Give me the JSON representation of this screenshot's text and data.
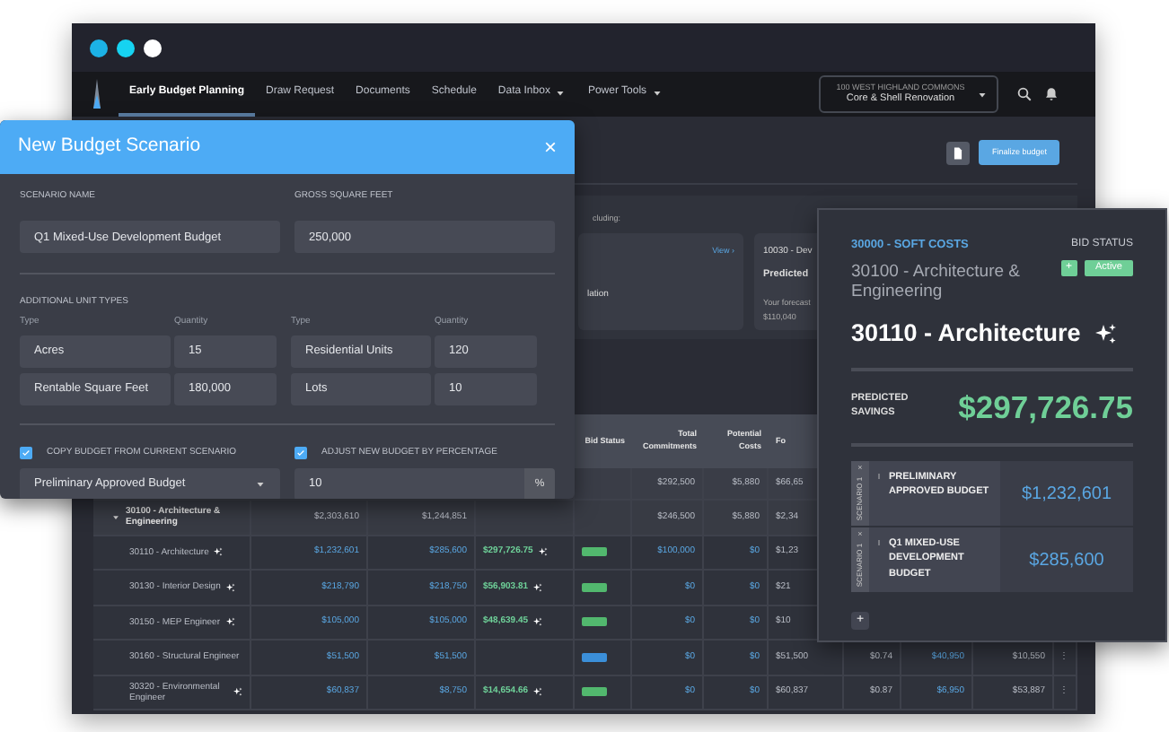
{
  "nav": {
    "tabs": [
      {
        "label": "Early Budget Planning",
        "selected": true,
        "dropdown": false
      },
      {
        "label": "Draw Request",
        "selected": false,
        "dropdown": false
      },
      {
        "label": "Documents",
        "selected": false,
        "dropdown": false
      },
      {
        "label": "Schedule",
        "selected": false,
        "dropdown": false
      },
      {
        "label": "Data Inbox",
        "selected": false,
        "dropdown": true
      },
      {
        "label": "Power Tools",
        "selected": false,
        "dropdown": true
      }
    ],
    "project": {
      "caption": "100 WEST HIGHLAND COMMONS",
      "name": "Core & Shell Renovation"
    }
  },
  "toolbar": {
    "primary_button": "Finalize budget"
  },
  "summary": {
    "intro": "cluding:",
    "cards": [
      {
        "link": "View ›",
        "line": "lation"
      },
      {
        "code": "10030 - Dev",
        "title": "Predicted",
        "note": "Your forecast",
        "amount": "$110,040"
      }
    ]
  },
  "table": {
    "columns": [
      "",
      "",
      "",
      "",
      "Bid Status",
      "Total Commitments",
      "Potential Costs",
      "Fo",
      "",
      "",
      "",
      ""
    ],
    "rows": [
      {
        "kind": "total",
        "cells": [
          "",
          "",
          "",
          "",
          "",
          "$292,500",
          "$5,880",
          "$66,65",
          "",
          "",
          "",
          ""
        ]
      },
      {
        "kind": "group",
        "expanded": true,
        "cells": [
          "30100 - Architecture & Engineering",
          "$2,303,610",
          "$1,244,851",
          "",
          "",
          "$246,500",
          "$5,880",
          "$2,34",
          "",
          "",
          "",
          ""
        ]
      },
      {
        "kind": "item",
        "ai": true,
        "bid_status": {
          "color": "#52b86e"
        },
        "cells": [
          "30110 - Architecture",
          "$1,232,601",
          "$285,600",
          "$297,726.75",
          "",
          "$100,000",
          "$0",
          "$1,23",
          "",
          "",
          "",
          ""
        ]
      },
      {
        "kind": "item",
        "ai": true,
        "bid_status": {
          "color": "#52b86e"
        },
        "cells": [
          "30130 - Interior Design",
          "$218,790",
          "$218,750",
          "$56,903.81",
          "",
          "$0",
          "$0",
          "$21",
          "",
          "",
          "",
          ""
        ]
      },
      {
        "kind": "item",
        "ai": true,
        "bid_status": {
          "color": "#52b86e"
        },
        "cells": [
          "30150 - MEP Engineer",
          "$105,000",
          "$105,000",
          "$48,639.45",
          "",
          "$0",
          "$0",
          "$10",
          "",
          "",
          "",
          ""
        ]
      },
      {
        "kind": "item",
        "ai": false,
        "bid_status": {
          "color": "#3b8fd9"
        },
        "cells": [
          "30160 - Structural Engineer",
          "$51,500",
          "$51,500",
          "",
          "",
          "$0",
          "$0",
          "$51,500",
          "$0.74",
          "$40,950",
          "$10,550",
          "⋮"
        ]
      },
      {
        "kind": "item",
        "ai": true,
        "bid_status": {
          "color": "#52b86e"
        },
        "cells": [
          "30320 - Environmental Engineer",
          "$60,837",
          "$8,750",
          "$14,654.66",
          "",
          "$0",
          "$0",
          "$60,837",
          "$0.87",
          "$6,950",
          "$53,887",
          "⋮"
        ]
      }
    ]
  },
  "modal": {
    "title": "New Budget Scenario",
    "close": "×",
    "fields": [
      {
        "label": "SCENARIO NAME",
        "value": "Q1 Mixed-Use Development Budget"
      },
      {
        "label": "GROSS SQUARE FEET",
        "value": "250,000"
      }
    ],
    "unit_types": {
      "heading": "ADDITIONAL UNIT TYPES",
      "column_labels": [
        "Type",
        "Quantity",
        "Type",
        "Quantity"
      ],
      "units": [
        {
          "type": "Acres",
          "quantity": "15"
        },
        {
          "type": "Residential Units",
          "quantity": "120"
        },
        {
          "type": "Rentable Square Feet",
          "quantity": "180,000"
        },
        {
          "type": "Lots",
          "quantity": "10"
        }
      ]
    },
    "copy": {
      "label": "COPY BUDGET FROM CURRENT SCENARIO",
      "checked": true,
      "value": "Preliminary Approved Budget"
    },
    "adjust": {
      "label": "ADJUST NEW BUDGET BY PERCENTAGE",
      "checked": true,
      "value": "10",
      "unit": "%"
    }
  },
  "detail_card": {
    "category": "30000 - SOFT COSTS",
    "bid_status_label": "BID STATUS",
    "add": "+",
    "status": "Active",
    "parent": "30100 - Architecture & Engineering",
    "title": "30110 - Architecture",
    "savings_label": "PREDICTED SAVINGS",
    "savings": "$297,726.75",
    "scenarios": [
      {
        "tag": "SCENARIO 1",
        "remove": "×",
        "name": "PRELIMINARY APPROVED BUDGET",
        "amount": "$1,232,601"
      },
      {
        "tag": "SCENARIO 1",
        "remove": "×",
        "name": "Q1 MIXED-USE DEVELOPMENT BUDGET",
        "amount": "$285,600"
      }
    ],
    "add_scenario": "+"
  }
}
